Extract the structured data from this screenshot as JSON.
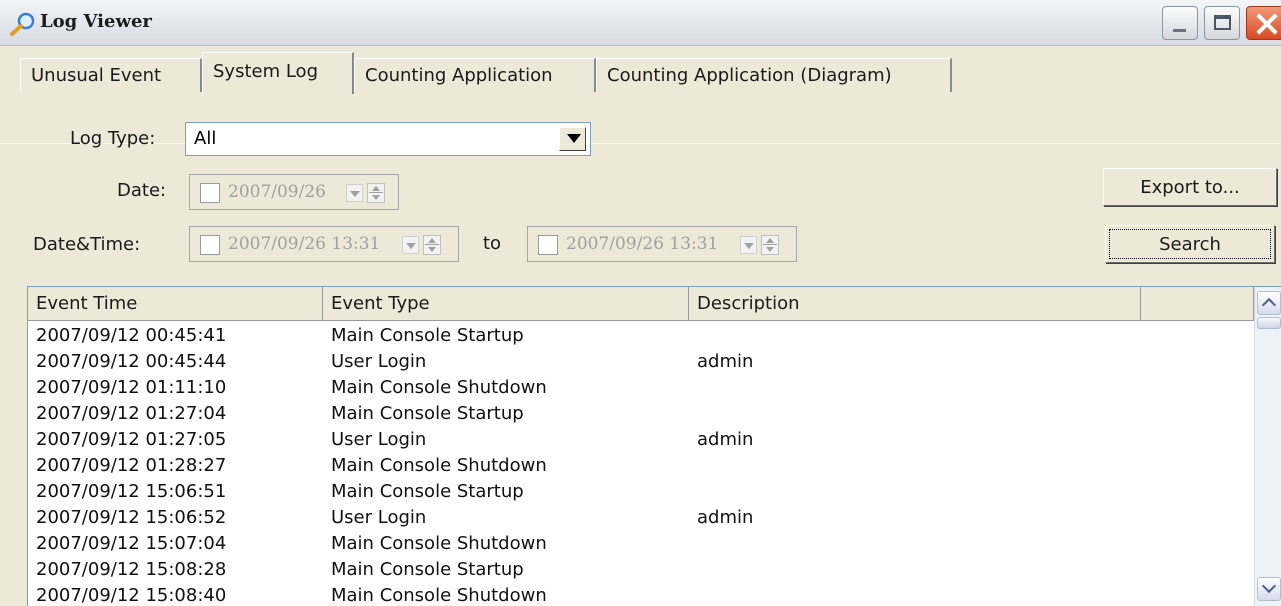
{
  "window": {
    "title": "Log Viewer",
    "icon": "magnifier-icon"
  },
  "tabs": [
    {
      "label": "Unusual Event"
    },
    {
      "label": "System Log",
      "active": true
    },
    {
      "label": "Counting Application"
    },
    {
      "label": "Counting Application (Diagram)"
    }
  ],
  "form": {
    "log_type_label": "Log Type:",
    "log_type_value": "All",
    "date_label": "Date:",
    "date_value": "2007/09/26",
    "datetime_label": "Date&Time:",
    "datetime_from": "2007/09/26 13:31",
    "to_label": "to",
    "datetime_to": "2007/09/26 13:31"
  },
  "buttons": {
    "export_label": "Export to...",
    "search_label": "Search"
  },
  "list": {
    "columns": [
      "Event Time",
      "Event Type",
      "Description",
      ""
    ],
    "rows": [
      {
        "time": "2007/09/12 00:45:41",
        "type": "Main Console Startup",
        "desc": ""
      },
      {
        "time": "2007/09/12 00:45:44",
        "type": "User Login",
        "desc": "admin"
      },
      {
        "time": "2007/09/12 01:11:10",
        "type": "Main Console Shutdown",
        "desc": ""
      },
      {
        "time": "2007/09/12 01:27:04",
        "type": "Main Console Startup",
        "desc": ""
      },
      {
        "time": "2007/09/12 01:27:05",
        "type": "User Login",
        "desc": "admin"
      },
      {
        "time": "2007/09/12 01:28:27",
        "type": "Main Console Shutdown",
        "desc": ""
      },
      {
        "time": "2007/09/12 15:06:51",
        "type": "Main Console Startup",
        "desc": ""
      },
      {
        "time": "2007/09/12 15:06:52",
        "type": "User Login",
        "desc": "admin"
      },
      {
        "time": "2007/09/12 15:07:04",
        "type": "Main Console Shutdown",
        "desc": ""
      },
      {
        "time": "2007/09/12 15:08:28",
        "type": "Main Console Startup",
        "desc": ""
      },
      {
        "time": "2007/09/12 15:08:40",
        "type": "Main Console Shutdown",
        "desc": ""
      }
    ]
  }
}
